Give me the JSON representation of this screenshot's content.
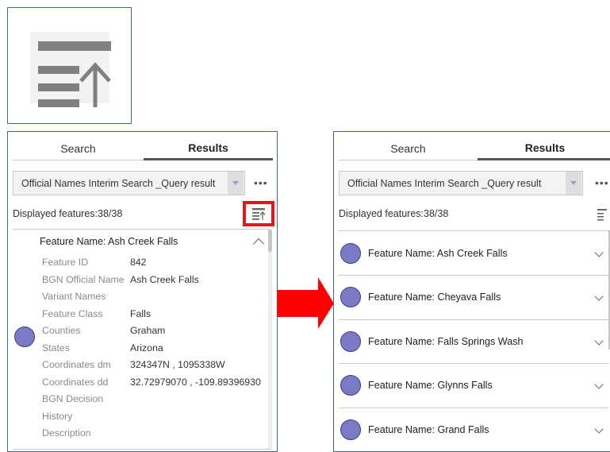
{
  "colors": {
    "accent_border": "#3b66b5",
    "highlight": "#e8141c",
    "arrow": "#ff0000",
    "marker_fill": "#7a7ac6"
  },
  "icon_box": {
    "icon": "sort-ascending-icon"
  },
  "left_panel": {
    "tabs": [
      "Search",
      "Results"
    ],
    "query_select": "Official Names Interim Search _Query result",
    "more": "•••",
    "displayed": "Displayed features:38/38",
    "feature": {
      "title": "Feature Name: Ash Creek Falls",
      "attributes": [
        {
          "label": "Feature ID",
          "value": "842"
        },
        {
          "label": "BGN Official Name",
          "value": "Ash Creek Falls"
        },
        {
          "label": "Variant Names",
          "value": ""
        },
        {
          "label": "Feature Class",
          "value": "Falls"
        },
        {
          "label": "Counties",
          "value": "Graham"
        },
        {
          "label": "States",
          "value": "Arizona"
        },
        {
          "label": "Coordinates dm",
          "value": "324347N , 1095338W"
        },
        {
          "label": "Coordinates dd",
          "value": "32.72979070 , -109.89396930"
        },
        {
          "label": "BGN Decision",
          "value": ""
        },
        {
          "label": "History",
          "value": ""
        },
        {
          "label": "Description",
          "value": ""
        }
      ]
    }
  },
  "right_panel": {
    "tabs": [
      "Search",
      "Results"
    ],
    "query_select": "Official Names Interim Search _Query result",
    "more": "•••",
    "displayed": "Displayed features:38/38",
    "features": [
      "Feature Name: Ash Creek Falls",
      "Feature Name: Cheyava Falls",
      "Feature Name: Falls Springs Wash",
      "Feature Name: Glynns Falls",
      "Feature Name: Grand Falls"
    ]
  }
}
